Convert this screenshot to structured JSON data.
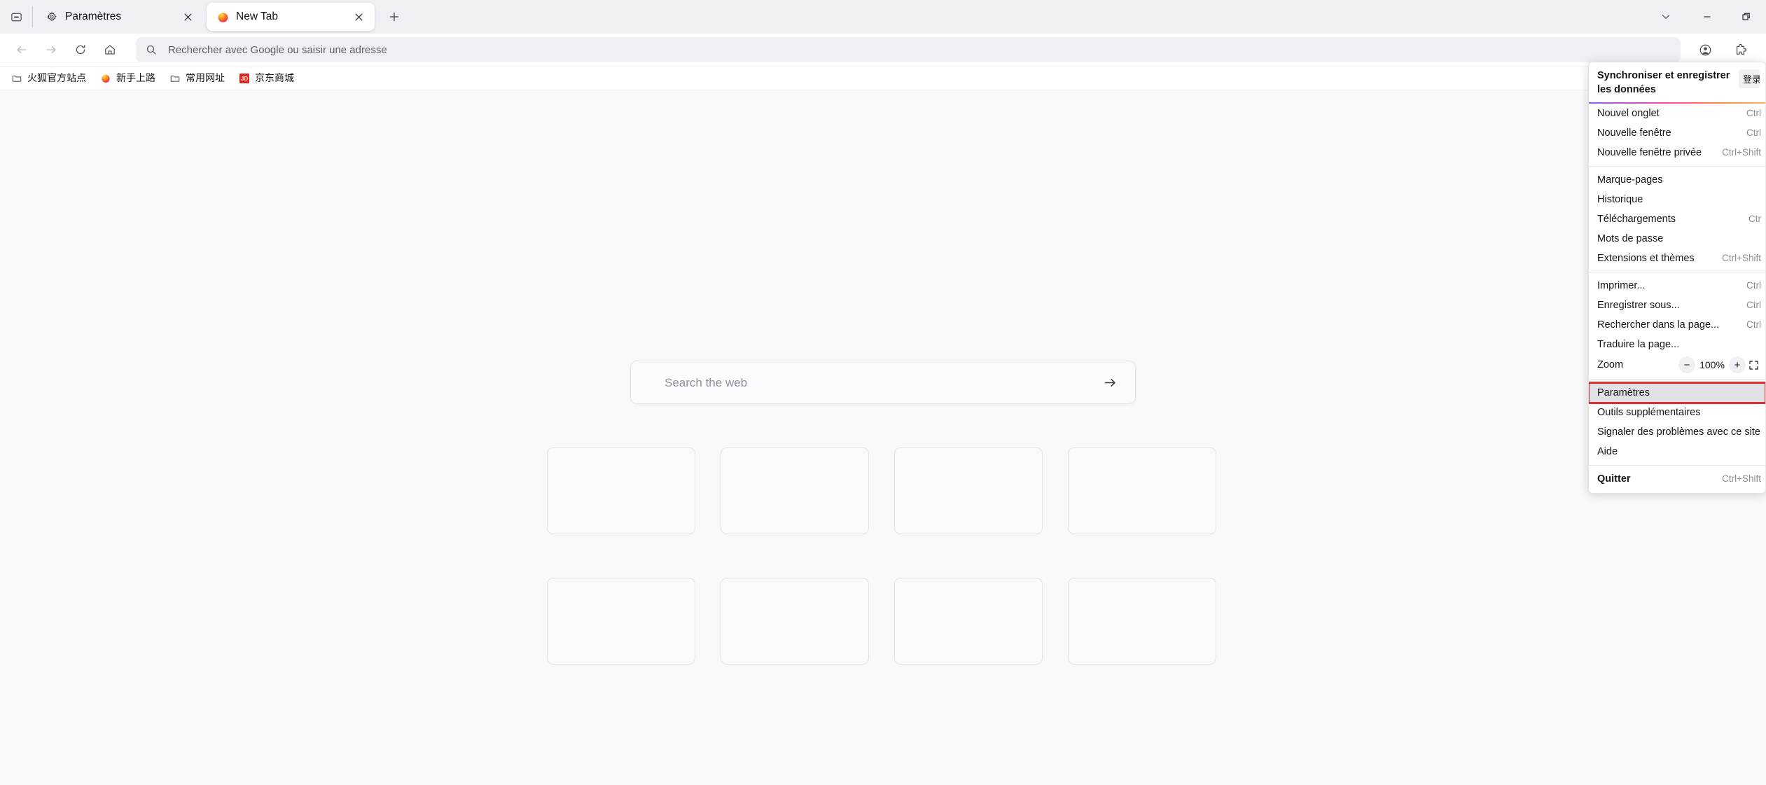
{
  "window": {
    "controls": [
      {
        "name": "tab-list-dropdown",
        "icon": "chevron-down-icon"
      },
      {
        "name": "minimize",
        "icon": "minimize-icon"
      },
      {
        "name": "restore",
        "icon": "restore-icon"
      }
    ]
  },
  "tabstrip": {
    "list_all_tabs_icon": "list-all-tabs-icon",
    "new_tab_icon": "plus-icon",
    "tabs": [
      {
        "title": "Paramètres",
        "favicon": "gear-icon",
        "active": false,
        "close_icon": "close-icon"
      },
      {
        "title": "New Tab",
        "favicon": "firefox-icon",
        "active": true,
        "close_icon": "close-icon"
      }
    ]
  },
  "navbar": {
    "back_icon": "arrow-left-icon",
    "forward_icon": "arrow-right-icon",
    "reload_icon": "reload-icon",
    "home_icon": "home-icon",
    "urlbar": {
      "search_icon": "search-icon",
      "value": "",
      "placeholder": "Rechercher avec Google ou saisir une adresse"
    },
    "account_icon": "account-circle-icon",
    "extensions_icon": "extension-puzzle-icon"
  },
  "bookmarks": [
    {
      "label": "火狐官方站点",
      "icon": "folder-icon"
    },
    {
      "label": "新手上路",
      "icon": "firefox-icon"
    },
    {
      "label": "常用网址",
      "icon": "folder-icon"
    },
    {
      "label": "京东商城",
      "icon": "jd-icon"
    }
  ],
  "newtab": {
    "search": {
      "placeholder": "Search the web",
      "value": "",
      "submit_icon": "arrow-right-icon"
    },
    "tiles_count": 8
  },
  "appmenu": {
    "header": {
      "title": "Synchroniser et enregistrer les données",
      "signin_label": "登录"
    },
    "groups": [
      {
        "items": [
          {
            "label": "Nouvel onglet",
            "shortcut": "Ctrl",
            "bold": false,
            "highlighted": false
          },
          {
            "label": "Nouvelle fenêtre",
            "shortcut": "Ctrl",
            "bold": false,
            "highlighted": false
          },
          {
            "label": "Nouvelle fenêtre privée",
            "shortcut": "Ctrl+Shift",
            "bold": false,
            "highlighted": false
          }
        ]
      },
      {
        "items": [
          {
            "label": "Marque-pages",
            "shortcut": "",
            "bold": false,
            "highlighted": false
          },
          {
            "label": "Historique",
            "shortcut": "",
            "bold": false,
            "highlighted": false
          },
          {
            "label": "Téléchargements",
            "shortcut": "Ctr",
            "bold": false,
            "highlighted": false
          },
          {
            "label": "Mots de passe",
            "shortcut": "",
            "bold": false,
            "highlighted": false
          },
          {
            "label": "Extensions et thèmes",
            "shortcut": "Ctrl+Shift",
            "bold": false,
            "highlighted": false
          }
        ]
      },
      {
        "items": [
          {
            "label": "Imprimer...",
            "shortcut": "Ctrl",
            "bold": false,
            "highlighted": false
          },
          {
            "label": "Enregistrer sous...",
            "shortcut": "Ctrl",
            "bold": false,
            "highlighted": false
          },
          {
            "label": "Rechercher dans la page...",
            "shortcut": "Ctrl",
            "bold": false,
            "highlighted": false
          },
          {
            "label": "Traduire la page...",
            "shortcut": "",
            "bold": false,
            "highlighted": false
          }
        ]
      }
    ],
    "zoom": {
      "label": "Zoom",
      "minus_label": "−",
      "value": "100%",
      "plus_label": "+",
      "fullscreen_icon": "fullscreen-icon"
    },
    "groups_after_zoom": [
      {
        "items": [
          {
            "label": "Paramètres",
            "shortcut": "",
            "bold": false,
            "highlighted": true
          },
          {
            "label": "Outils supplémentaires",
            "shortcut": "",
            "bold": false,
            "highlighted": false
          },
          {
            "label": "Signaler des problèmes avec ce site",
            "shortcut": "",
            "bold": false,
            "highlighted": false
          },
          {
            "label": "Aide",
            "shortcut": "",
            "bold": false,
            "highlighted": false
          }
        ]
      },
      {
        "items": [
          {
            "label": "Quitter",
            "shortcut": "Ctrl+Shift",
            "bold": true,
            "highlighted": false
          }
        ]
      }
    ],
    "highlight_color": "#e22b2b"
  }
}
